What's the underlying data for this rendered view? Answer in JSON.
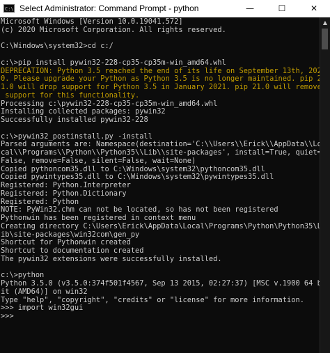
{
  "window": {
    "title": "Select Administrator: Command Prompt - python",
    "icon": "cmd-icon",
    "icon_text": "C:\\",
    "minimize": "—",
    "maximize": "☐",
    "close": "✕",
    "colors": {
      "background": "#0c0c0c",
      "text": "#cccccc",
      "warning": "#c19c00",
      "titlebar": "#ffffff"
    }
  },
  "console": {
    "lines": [
      "Microsoft Windows [Version 10.0.19041.572]",
      "(c) 2020 Microsoft Corporation. All rights reserved.",
      "",
      "C:\\Windows\\system32>cd c:/",
      "",
      "c:\\>pip install pywin32-228-cp35-cp35m-win_amd64.whl",
      "DEPRECATION: Python 3.5 reached the end of its life on September 13th, 202",
      "0. Please upgrade your Python as Python 3.5 is no longer maintained. pip 2",
      "1.0 will drop support for Python 3.5 in January 2021. pip 21.0 will remove",
      " support for this functionality.",
      "Processing c:\\pywin32-228-cp35-cp35m-win_amd64.whl",
      "Installing collected packages: pywin32",
      "Successfully installed pywin32-228",
      "",
      "c:\\>pywin32_postinstall.py -install",
      "Parsed arguments are: Namespace(destination='C:\\\\Users\\\\Erick\\\\AppData\\\\Lo",
      "cal\\\\Programs\\\\Python\\\\Python35\\\\Lib\\\\site-packages', install=True, quiet=",
      "False, remove=False, silent=False, wait=None)",
      "Copied pythoncom35.dll to C:\\Windows\\system32\\pythoncom35.dll",
      "Copied pywintypes35.dll to C:\\Windows\\system32\\pywintypes35.dll",
      "Registered: Python.Interpreter",
      "Registered: Python.Dictionary",
      "Registered: Python",
      "NOTE: PyWin32.chm can not be located, so has not been registered",
      "Pythonwin has been registered in context menu",
      "Creating directory C:\\Users\\Erick\\AppData\\Local\\Programs\\Python\\Python35\\L",
      "ib\\site-packages\\win32com\\gen_py",
      "Shortcut for Pythonwin created",
      "Shortcut to documentation created",
      "The pywin32 extensions were successfully installed.",
      "",
      "c:\\>python",
      "Python 3.5.0 (v3.5.0:374f501f4567, Sep 13 2015, 02:27:37) [MSC v.1900 64 b",
      "it (AMD64)] on win32",
      "Type \"help\", \"copyright\", \"credits\" or \"license\" for more information.",
      ">>> import win32gui",
      ">>>"
    ]
  },
  "scrollbar": {
    "up": "▲"
  }
}
